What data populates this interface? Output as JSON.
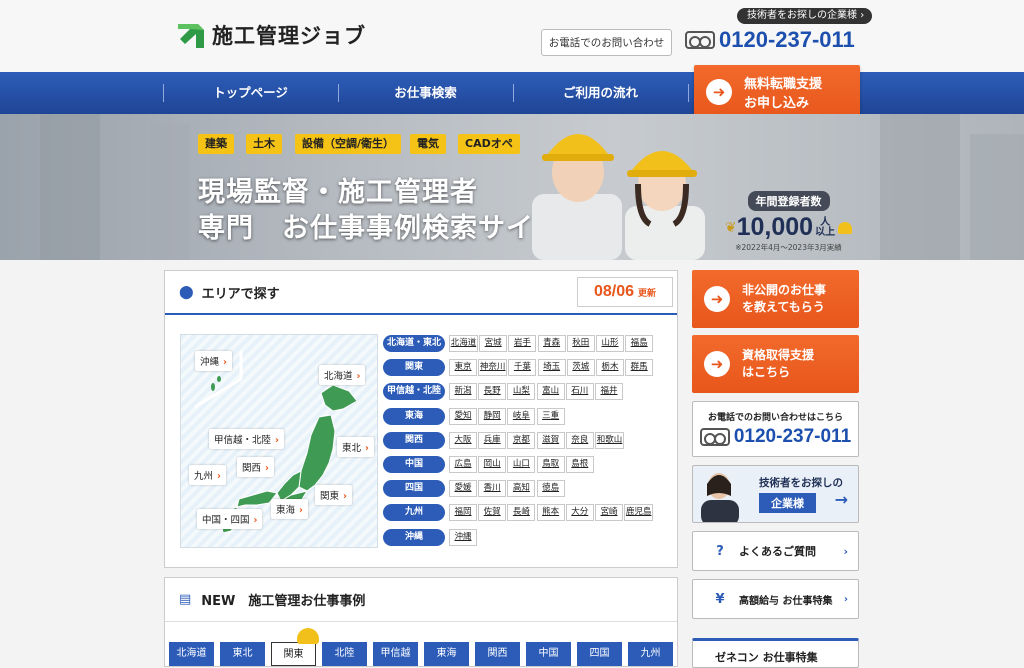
{
  "header": {
    "logo_text": "施工管理ジョブ",
    "corp_link": "技術者をお探しの企業様",
    "contact_button": "お電話でのお問い合わせ",
    "phone": "0120-237-011"
  },
  "nav": {
    "items": [
      "トップページ",
      "お仕事検索",
      "ご利用の流れ"
    ],
    "cta_line1": "無料転職支援",
    "cta_line2": "お申し込み"
  },
  "hero": {
    "tags": [
      "建築",
      "土木",
      "設備（空調/衛生）",
      "電気",
      "CADオペ"
    ],
    "title_line1": "現場監督・施工管理者",
    "title_line2": "専門　お仕事事例検索サイト",
    "stats_label": "年間登録者数",
    "stats_value": "10,000",
    "stats_unit_top": "人",
    "stats_unit_bottom": "以上",
    "stats_note": "※2022年4月～2023年3月実績"
  },
  "area": {
    "title": "エリアで探す",
    "date": "08/06",
    "date_suffix": "更新",
    "map_labels": [
      "沖縄",
      "北海道",
      "東北",
      "甲信越・北陸",
      "関西",
      "九州",
      "関東",
      "東海",
      "中国・四国"
    ],
    "regions": [
      {
        "name": "北海道・東北",
        "prefs": [
          "北海道",
          "宮城",
          "岩手",
          "青森",
          "秋田",
          "山形",
          "福島"
        ]
      },
      {
        "name": "関東",
        "prefs": [
          "東京",
          "神奈川",
          "千葉",
          "埼玉",
          "茨城",
          "栃木",
          "群馬"
        ]
      },
      {
        "name": "甲信越・北陸",
        "prefs": [
          "新潟",
          "長野",
          "山梨",
          "富山",
          "石川",
          "福井"
        ]
      },
      {
        "name": "東海",
        "prefs": [
          "愛知",
          "静岡",
          "岐阜",
          "三重"
        ]
      },
      {
        "name": "関西",
        "prefs": [
          "大阪",
          "兵庫",
          "京都",
          "滋賀",
          "奈良",
          "和歌山"
        ]
      },
      {
        "name": "中国",
        "prefs": [
          "広島",
          "岡山",
          "山口",
          "鳥取",
          "島根"
        ]
      },
      {
        "name": "四国",
        "prefs": [
          "愛媛",
          "香川",
          "高知",
          "徳島"
        ]
      },
      {
        "name": "九州",
        "prefs": [
          "福岡",
          "佐賀",
          "長崎",
          "熊本",
          "大分",
          "宮崎",
          "鹿児島"
        ]
      },
      {
        "name": "沖縄",
        "prefs": [
          "沖縄"
        ]
      }
    ]
  },
  "new_cases": {
    "title": "NEW　施工管理お仕事事例",
    "tabs": [
      "北海道",
      "東北",
      "関東",
      "北陸",
      "甲信越",
      "東海",
      "関西",
      "中国",
      "四国",
      "九州"
    ],
    "active_tab": "関東"
  },
  "sidebar": {
    "hidden_jobs_line1": "非公開のお仕事",
    "hidden_jobs_line2": "を教えてもらう",
    "license_line1": "資格取得支援",
    "license_line2": "はこちら",
    "phone_label": "お電話でのお問い合わせはこちら",
    "phone": "0120-237-011",
    "corp_line1": "技術者をお探しの",
    "corp_line2": "企業様",
    "faq": "よくあるご質問",
    "high_salary": "高額給与 お仕事特集",
    "zenecon": "ゼネコン お仕事特集"
  },
  "colors": {
    "brand_blue": "#2c5cb8",
    "accent_orange": "#e8561b",
    "tag_yellow": "#f5c316"
  }
}
